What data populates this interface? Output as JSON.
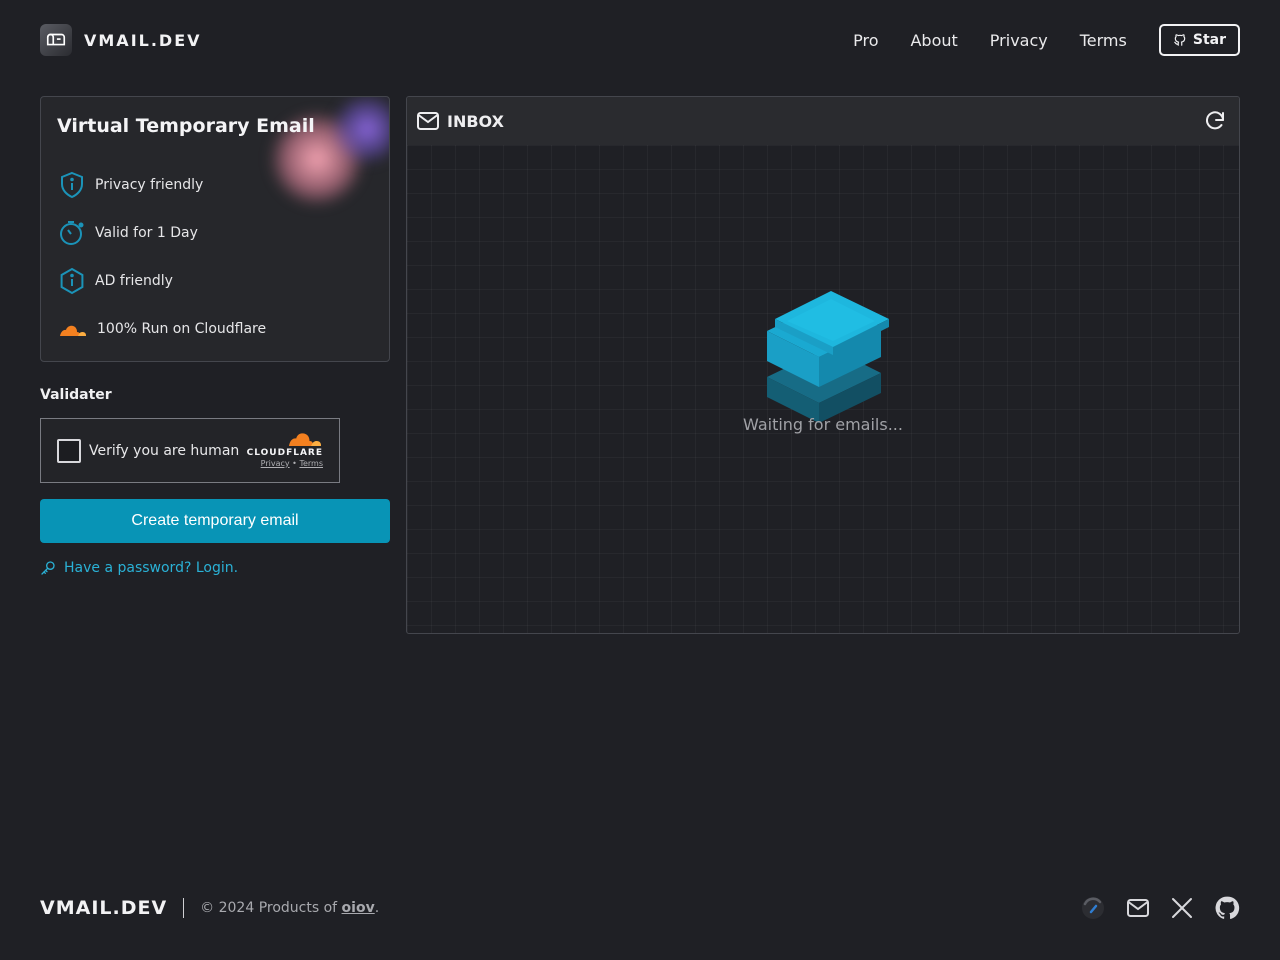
{
  "header": {
    "brand": "VMAIL.DEV",
    "nav": [
      "Pro",
      "About",
      "Privacy",
      "Terms"
    ],
    "star_label": "Star"
  },
  "features_card": {
    "title": "Virtual Temporary Email",
    "items": [
      {
        "icon": "shield-info-icon",
        "label": "Privacy friendly"
      },
      {
        "icon": "timer-icon",
        "label": "Valid for 1 Day"
      },
      {
        "icon": "info-hexagon-icon",
        "label": "AD friendly"
      },
      {
        "icon": "cloudflare-cloud-icon",
        "label": "100% Run on Cloudflare"
      }
    ]
  },
  "validater": {
    "label": "Validater",
    "checkbox_text": "Verify you are human",
    "provider": "CLOUDFLARE",
    "privacy_link": "Privacy",
    "separator": "•",
    "terms_link": "Terms"
  },
  "actions": {
    "create_label": "Create temporary email",
    "login_label": "Have a password? Login."
  },
  "inbox": {
    "title": "INBOX",
    "status": "Waiting for emails..."
  },
  "footer": {
    "brand": "VMAIL.DEV",
    "copyright_prefix": "© 2024 Products of ",
    "company": "oiov",
    "copyright_suffix": "."
  },
  "colors": {
    "background": "#1f2025",
    "accent": "#0894b6",
    "link": "#2ab1d6",
    "cloudflare": "#f38020"
  }
}
